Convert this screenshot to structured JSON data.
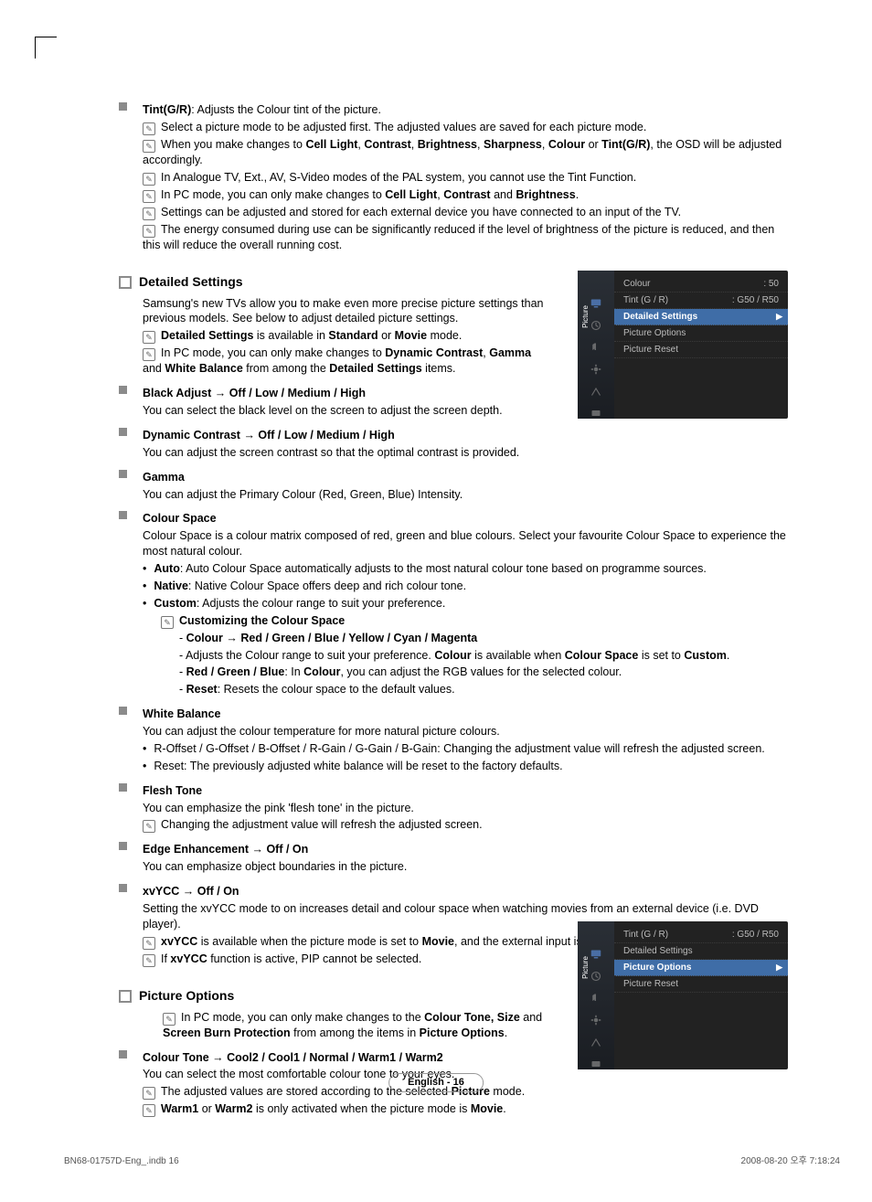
{
  "tint": {
    "title_bold": "Tint(G/R)",
    "title_rest": ": Adjusts the Colour tint of the picture.",
    "notes": [
      "Select a picture mode to be adjusted first. The adjusted values are saved for each picture mode.",
      "When you make changes to <b>Cell Light</b>, <b>Contrast</b>, <b>Brightness</b>, <b>Sharpness</b>, <b>Colour</b> or <b>Tint(G/R)</b>, the OSD will be adjusted accordingly.",
      "In Analogue TV, Ext., AV, S-Video modes of the PAL system, you cannot use the Tint Function.",
      "In PC mode, you can only make changes to <b>Cell Light</b>, <b>Contrast</b> and <b>Brightness</b>.",
      "Settings can be adjusted and stored for each external device you have connected to an input of the TV.",
      "The energy consumed during use can be significantly reduced if the level of brightness of the picture is reduced, and then this will reduce the overall running cost."
    ]
  },
  "detailed": {
    "title": "Detailed Settings",
    "intro": "Samsung's new TVs allow you to make even more precise picture settings than previous models. See below to adjust detailed picture settings.",
    "notes": [
      "<b>Detailed Settings</b> is available in <b>Standard</b> or <b>Movie</b> mode.",
      "In PC mode, you can only make changes to <b>Dynamic Contrast</b>, <b>Gamma</b> and <b>White Balance</b> from among the <b>Detailed Settings</b> items."
    ],
    "black": {
      "title": "Black Adjust → Off / Low / Medium / High",
      "desc": "You can select the black level on the screen to adjust the screen depth."
    },
    "dynamic": {
      "title": "Dynamic Contrast → Off / Low / Medium / High",
      "desc": "You can adjust the screen contrast so that the optimal contrast is provided."
    },
    "gamma": {
      "title": "Gamma",
      "desc": "You can adjust the Primary Colour (Red, Green, Blue) Intensity."
    },
    "colourSpace": {
      "title": "Colour Space",
      "desc": "Colour Space is a colour matrix composed of red, green and blue colours. Select your favourite Colour Space to experience the most natural colour.",
      "auto": "<b>Auto</b>: Auto Colour Space automatically adjusts to the most natural colour tone based on programme sources.",
      "native": "<b>Native</b>: Native Colour Space offers deep and rich colour tone.",
      "custom": "<b>Custom</b>: Adjusts the colour range to suit your preference.",
      "customNoteTitle": "Customizing the Colour Space",
      "d1": "<b>Colour → Red / Green / Blue / Yellow / Cyan / Magenta</b>",
      "d2": "Adjusts the Colour range to suit your preference. <b>Colour</b> is available when <b>Colour Space</b> is set to <b>Custom</b>.",
      "d3": "<b>Red / Green / Blue</b>: In <b>Colour</b>, you can adjust the RGB values for the selected colour.",
      "d4": "<b>Reset</b>: Resets the colour space to the default values."
    },
    "white": {
      "title": "White Balance",
      "desc": "You can adjust the colour temperature for more natural picture colours.",
      "b1": "R-Offset / G-Offset / B-Offset / R-Gain / G-Gain / B-Gain: Changing the adjustment value will refresh the adjusted screen.",
      "b2": "Reset: The previously adjusted white balance will be reset to the factory defaults."
    },
    "flesh": {
      "title": "Flesh Tone",
      "desc": "You can emphasize the pink 'flesh tone' in the picture.",
      "note": "Changing the adjustment value will refresh the adjusted screen."
    },
    "edge": {
      "title": "Edge Enhancement → Off / On",
      "desc": "You can emphasize object boundaries in the picture."
    },
    "xvycc": {
      "title": "xvYCC → Off / On",
      "desc": "Setting the xvYCC mode to on increases detail and colour space when watching movies from an external device (i.e. DVD player).",
      "n1": "<b>xvYCC</b> is available when the picture mode is set to <b>Movie</b>, and the external input is set to <b>HDMI</b> or <b>Component</b> mode.",
      "n2": "If <b>xvYCC</b> function is active, PIP cannot be selected."
    }
  },
  "pictureOptions": {
    "title": "Picture Options",
    "note": "In PC mode, you can only make changes to the <b>Colour Tone, Size</b> and <b>Screen Burn Protection</b> from among the items in <b>Picture Options</b>.",
    "colourTone": {
      "title": "Colour Tone → Cool2 / Cool1 / Normal / Warm1 / Warm2",
      "desc": "You can select the most comfortable colour tone to your eyes.",
      "n1": "The adjusted values are stored according to the selected <b>Picture</b> mode.",
      "n2": "<b>Warm1</b> or <b>Warm2</b> is only activated when the picture mode is <b>Movie</b>."
    }
  },
  "menu1": {
    "sideLabel": "Picture",
    "colour": {
      "label": "Colour",
      "value": ": 50"
    },
    "tint": {
      "label": "Tint (G / R)",
      "value": ": G50 / R50"
    },
    "selected": "Detailed Settings",
    "po": "Picture Options",
    "pr": "Picture Reset"
  },
  "menu2": {
    "sideLabel": "Picture",
    "tint": {
      "label": "Tint (G / R)",
      "value": ": G50 / R50"
    },
    "ds": "Detailed Settings",
    "selected": "Picture Options",
    "pr": "Picture Reset"
  },
  "footer": {
    "page": "English - 16",
    "left": "BN68-01757D-Eng_.indb   16",
    "right": "2008-08-20   오후 7:18:24"
  }
}
